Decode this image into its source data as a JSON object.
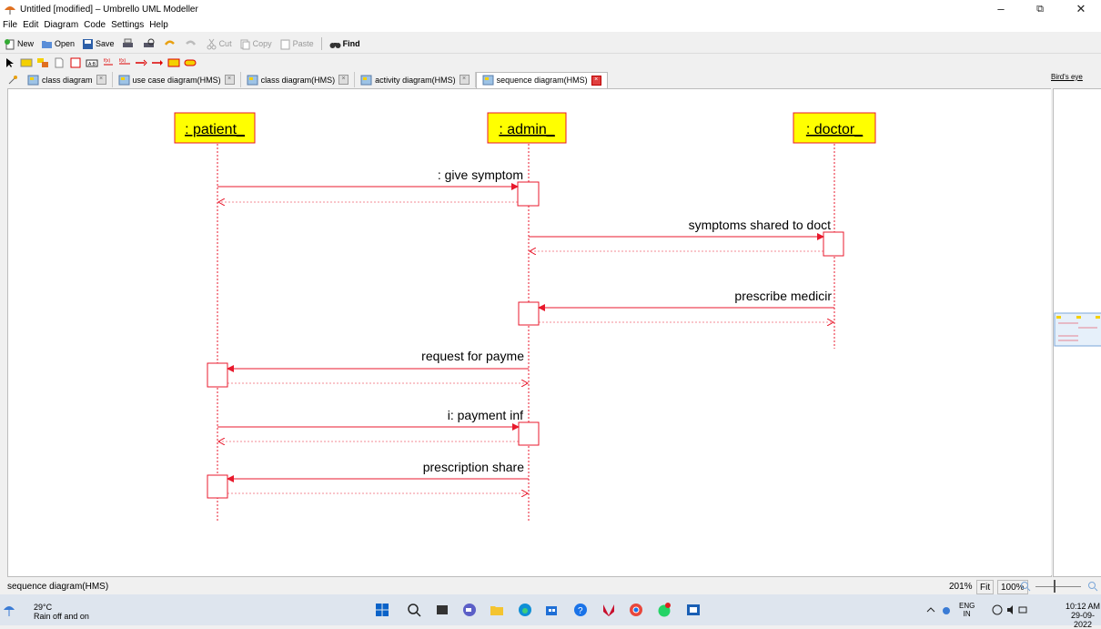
{
  "window": {
    "title": "Untitled [modified] – Umbrello UML Modeller",
    "controls": {
      "minimize": "–",
      "maximize": "⧉",
      "close": "✕"
    }
  },
  "menu": [
    "File",
    "Edit",
    "Diagram",
    "Code",
    "Settings",
    "Help"
  ],
  "toolbar": {
    "new": "New",
    "open": "Open",
    "save": "Save",
    "cut": "Cut",
    "copy": "Copy",
    "paste": "Paste",
    "find": "Find"
  },
  "tabs": [
    {
      "label": "class diagram",
      "active": false
    },
    {
      "label": "use case diagram(HMS)",
      "active": false
    },
    {
      "label": "class diagram(HMS)",
      "active": false
    },
    {
      "label": "activity diagram(HMS)",
      "active": false
    },
    {
      "label": "sequence diagram(HMS)",
      "active": true
    }
  ],
  "birds_eye": {
    "title": "Bird's eye"
  },
  "diagram": {
    "objects": [
      ": patient_",
      ": admin_",
      ": doctor_"
    ],
    "messages": [
      ": give symptom",
      "symptoms shared to doct",
      "prescribe medicir",
      "request for payme",
      "i: payment inf",
      "prescription share"
    ],
    "colors": {
      "object_fill": "#ffff00",
      "line": "#e8192c"
    }
  },
  "status": {
    "text": "sequence diagram(HMS)",
    "zoom": "201%",
    "fit": "Fit",
    "zoom_100": "100%"
  },
  "taskbar": {
    "temperature": "29°C",
    "weather": "Rain off and on",
    "lang_top": "ENG",
    "lang_bottom": "IN",
    "time": "10:12 AM",
    "date": "29-09-2022"
  }
}
